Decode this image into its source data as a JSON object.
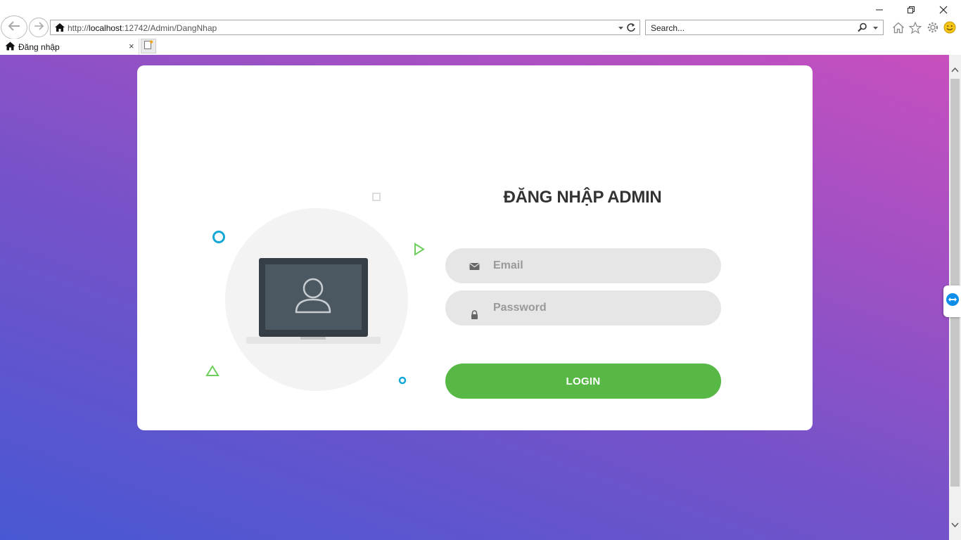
{
  "browser": {
    "url_prefix": "http://",
    "url_host": "localhost",
    "url_rest": ":12742/Admin/DangNhap",
    "search_placeholder": "Search...",
    "tab_title": "Đăng nhập",
    "tab_close": "×"
  },
  "login": {
    "title": "ĐĂNG NHẬP ADMIN",
    "email_placeholder": "Email",
    "password_placeholder": "Password",
    "button_label": "LOGIN"
  },
  "colors": {
    "accent_green": "#57b846",
    "field_bg": "#e6e6e6",
    "gradient_start": "#4858d3",
    "gradient_end": "#c84fbe",
    "deco_cyan": "#15a7d8",
    "deco_green": "#6ccf5a"
  },
  "icons": {
    "browser_back": "back-arrow-icon",
    "browser_forward": "forward-arrow-icon",
    "home": "home-icon",
    "refresh": "refresh-icon",
    "search": "magnifier-icon",
    "favorites": "star-icon",
    "settings": "gear-icon",
    "feedback": "smiley-icon",
    "email": "envelope-icon",
    "password": "lock-icon",
    "illustration": "laptop-user-icon"
  }
}
